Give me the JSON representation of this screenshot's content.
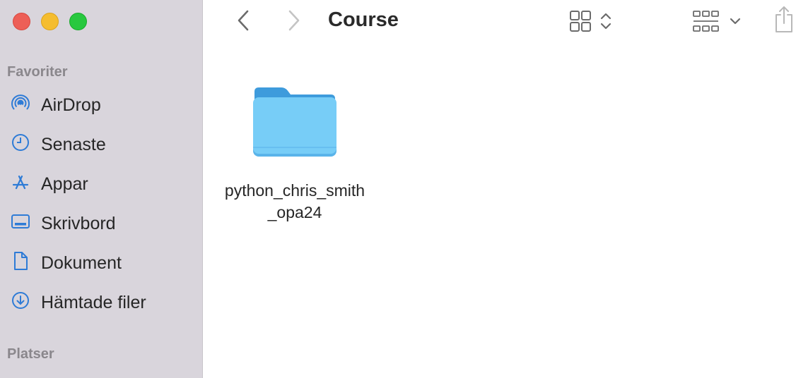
{
  "window": {
    "title": "Course"
  },
  "sidebar": {
    "favorites_heading": "Favoriter",
    "places_heading": "Platser",
    "items": [
      {
        "label": "AirDrop",
        "icon": "airdrop-icon"
      },
      {
        "label": "Senaste",
        "icon": "clock-icon"
      },
      {
        "label": "Appar",
        "icon": "apps-icon"
      },
      {
        "label": "Skrivbord",
        "icon": "desktop-icon"
      },
      {
        "label": "Dokument",
        "icon": "document-icon"
      },
      {
        "label": "Hämtade filer",
        "icon": "download-icon"
      }
    ]
  },
  "content": {
    "items": [
      {
        "name": "python_chris_smith_opa24",
        "icon": "folder-icon"
      }
    ]
  },
  "colors": {
    "accent": "#2e7bd6",
    "folder": "#6ec6f5",
    "sidebar_bg": "#d9d5dc"
  }
}
